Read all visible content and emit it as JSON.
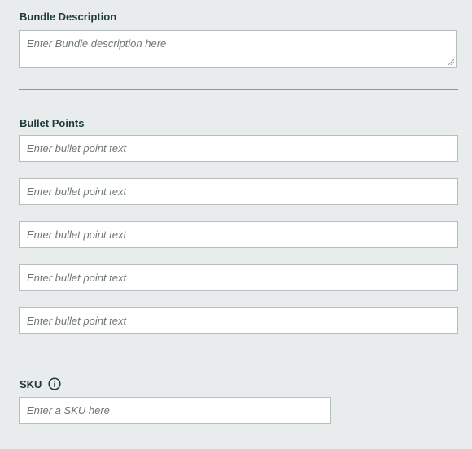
{
  "bundle_description": {
    "label": "Bundle Description",
    "placeholder": "Enter Bundle description here"
  },
  "bullet_points": {
    "label": "Bullet Points",
    "items": [
      {
        "placeholder": "Enter bullet point text"
      },
      {
        "placeholder": "Enter bullet point text"
      },
      {
        "placeholder": "Enter bullet point text"
      },
      {
        "placeholder": "Enter bullet point text"
      },
      {
        "placeholder": "Enter bullet point text"
      }
    ]
  },
  "sku": {
    "label": "SKU",
    "info_icon": "info-circle-icon",
    "placeholder": "Enter a SKU here"
  },
  "colors": {
    "background": "#e9ecec",
    "label_text": "#1e3a3a",
    "placeholder_text": "#6f7676",
    "input_border": "#b8bcbc",
    "divider": "#8f9595"
  }
}
